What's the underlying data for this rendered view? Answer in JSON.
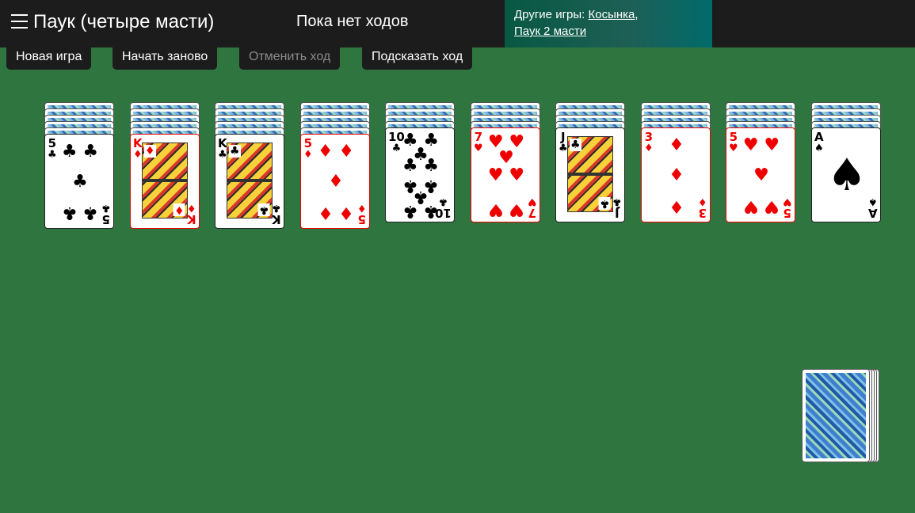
{
  "header": {
    "title": "Паук (четыре масти)",
    "moves_status": "Пока нет ходов",
    "other_games_label": "Другие игры: ",
    "links": [
      "Косынка",
      "Паук 2 масти"
    ]
  },
  "toolbar": {
    "new_game": "Новая игра",
    "restart": "Начать заново",
    "undo": "Отменить ход",
    "hint": "Подсказать ход"
  },
  "colors": {
    "felt": "#2f7540",
    "bar": "#1c1c1c",
    "red_suit": "#e00000"
  },
  "tableau": [
    {
      "hidden": 5,
      "top": {
        "rank": "5",
        "suit": "♣",
        "color": "black"
      }
    },
    {
      "hidden": 5,
      "top": {
        "rank": "K",
        "suit": "♦",
        "color": "red"
      }
    },
    {
      "hidden": 5,
      "top": {
        "rank": "K",
        "suit": "♣",
        "color": "black"
      }
    },
    {
      "hidden": 5,
      "top": {
        "rank": "5",
        "suit": "♦",
        "color": "red"
      }
    },
    {
      "hidden": 4,
      "top": {
        "rank": "10",
        "suit": "♣",
        "color": "black"
      }
    },
    {
      "hidden": 4,
      "top": {
        "rank": "7",
        "suit": "♥",
        "color": "red"
      }
    },
    {
      "hidden": 4,
      "top": {
        "rank": "J",
        "suit": "♣",
        "color": "black"
      }
    },
    {
      "hidden": 4,
      "top": {
        "rank": "3",
        "suit": "♦",
        "color": "red"
      }
    },
    {
      "hidden": 4,
      "top": {
        "rank": "5",
        "suit": "♥",
        "color": "red"
      }
    },
    {
      "hidden": 4,
      "top": {
        "rank": "A",
        "suit": "♠",
        "color": "black"
      }
    }
  ],
  "stock": {
    "piles": 5
  }
}
